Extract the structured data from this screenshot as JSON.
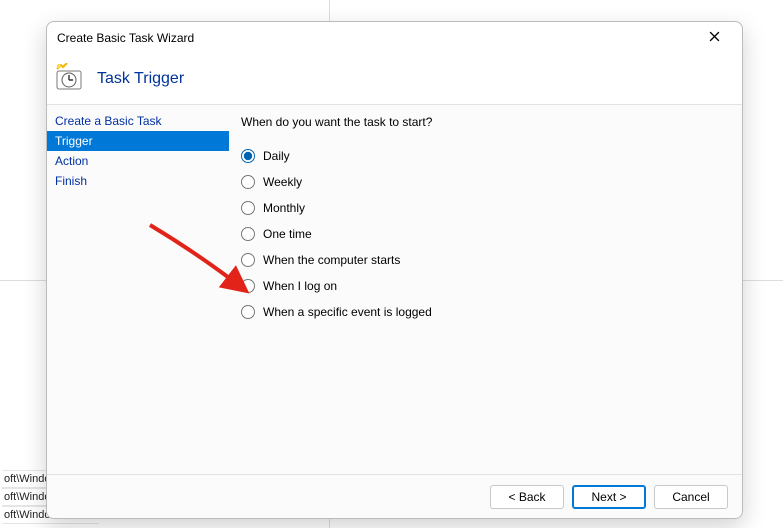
{
  "backdrop": {
    "paths": [
      "oft\\Windo",
      "oft\\Windows\\O...",
      "oft\\Windows\\Fli"
    ]
  },
  "wizard": {
    "title": "Create Basic Task Wizard",
    "header": "Task Trigger",
    "steps": [
      {
        "label": "Create a Basic Task",
        "active": false
      },
      {
        "label": "Trigger",
        "active": true
      },
      {
        "label": "Action",
        "active": false
      },
      {
        "label": "Finish",
        "active": false
      }
    ],
    "prompt": "When do you want the task to start?",
    "options": [
      {
        "label": "Daily",
        "checked": true
      },
      {
        "label": "Weekly",
        "checked": false
      },
      {
        "label": "Monthly",
        "checked": false
      },
      {
        "label": "One time",
        "checked": false
      },
      {
        "label": "When the computer starts",
        "checked": false
      },
      {
        "label": "When I log on",
        "checked": false
      },
      {
        "label": "When a specific event is logged",
        "checked": false
      }
    ],
    "buttons": {
      "back": "< Back",
      "next": "Next >",
      "cancel": "Cancel"
    }
  }
}
